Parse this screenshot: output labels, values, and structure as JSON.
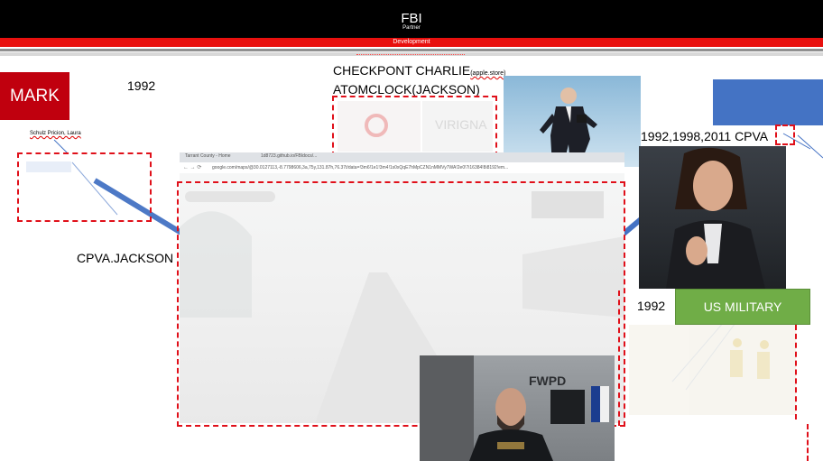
{
  "header": {
    "title": "FBI",
    "subtitle": "Partner",
    "banner": "Development"
  },
  "labels": {
    "mark": "MARK",
    "year_1992_a": "1992",
    "checkpoint": "CHECKPONT CHARLIE",
    "apple_store": "(apple.store)",
    "atomclock": "ATOMCLOCK(JACKSON)",
    "schulz": "Schulz Pricion, Laura",
    "cpva_jackson": "CPVA.JACKSON",
    "years_cpva": "1992,1998,2011 CPVA",
    "year_1992_b": "1992",
    "us_military": "US MILITARY",
    "virginia": "VIRIGNA",
    "fwpd": "FWPD"
  },
  "browser": {
    "tab1": "Tarrant County - Home",
    "tab2": "1d8723.github.io/FBIdocs/...",
    "url": "google.com/maps/@30.0127113,-8.7798606,3a,75y,131.87h,76.37t/data=!3m6!1e1!3m4!1s0xQqE7hMpCZN1nMMVy7WA!2e0!7i16384!8i8192!em..."
  },
  "colors": {
    "red": "#e8100e",
    "mark_red": "#c0000e",
    "blue_box": "#4473c4",
    "military_green": "#70ad47",
    "connector_blue": "#4472c4",
    "dashed_red": "#e0101a"
  }
}
